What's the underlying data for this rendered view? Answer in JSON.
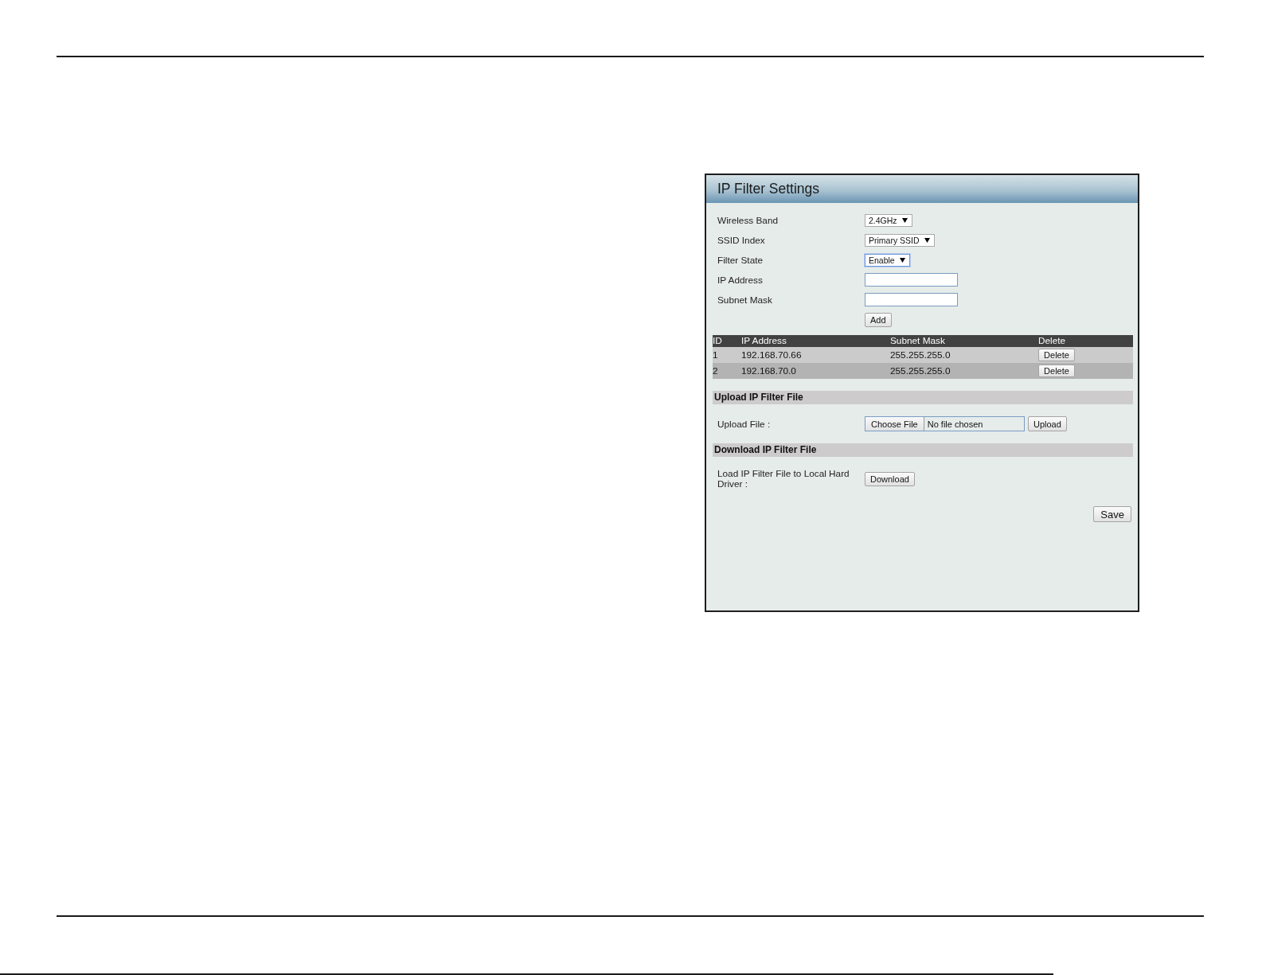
{
  "panel": {
    "title": "IP Filter Settings"
  },
  "settings": [
    {
      "kind": "select",
      "label": "Wireless Band",
      "value": "2.4GHz",
      "focused": false
    },
    {
      "kind": "select",
      "label": "SSID Index",
      "value": "Primary SSID",
      "focused": false
    },
    {
      "kind": "select",
      "label": "Filter State",
      "value": "Enable",
      "focused": true
    },
    {
      "kind": "text",
      "label": "IP Address"
    },
    {
      "kind": "text",
      "label": "Subnet Mask"
    }
  ],
  "add_button": "Add",
  "table": {
    "columns": [
      "ID",
      "IP Address",
      "Subnet Mask",
      "Delete"
    ],
    "rows": [
      {
        "cells": [
          "1",
          "192.168.70.66",
          "255.255.255.0"
        ],
        "action": "Delete"
      },
      {
        "cells": [
          "2",
          "192.168.70.0",
          "255.255.255.0"
        ],
        "action": "Delete"
      }
    ]
  },
  "upload_section": {
    "title": "Upload IP Filter File",
    "label": "Upload File :",
    "choose_button": "Choose File",
    "file_status": "No file chosen",
    "upload_button": "Upload"
  },
  "download_section": {
    "title": "Download IP Filter File",
    "label": "Load IP Filter File to Local Hard Driver :",
    "download_button": "Download"
  },
  "save_button": "Save"
}
